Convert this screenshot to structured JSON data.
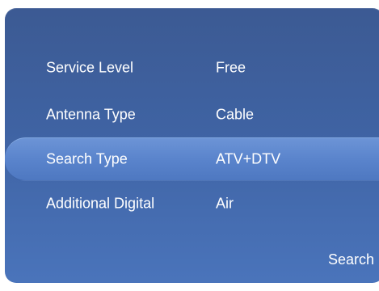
{
  "menu": {
    "rows": [
      {
        "label": "Service Level",
        "value": "Free"
      },
      {
        "label": "Antenna Type",
        "value": "Cable"
      },
      {
        "label": "Search Type",
        "value": "ATV+DTV"
      },
      {
        "label": "Additional Digital",
        "value": "Air"
      }
    ],
    "selected_index": 2
  },
  "actions": {
    "search_label": "Search"
  },
  "colors": {
    "panel_top": "#3c5a93",
    "panel_bottom": "#4a74bb",
    "highlight": "#5a84cc",
    "text": "#ffffff"
  }
}
